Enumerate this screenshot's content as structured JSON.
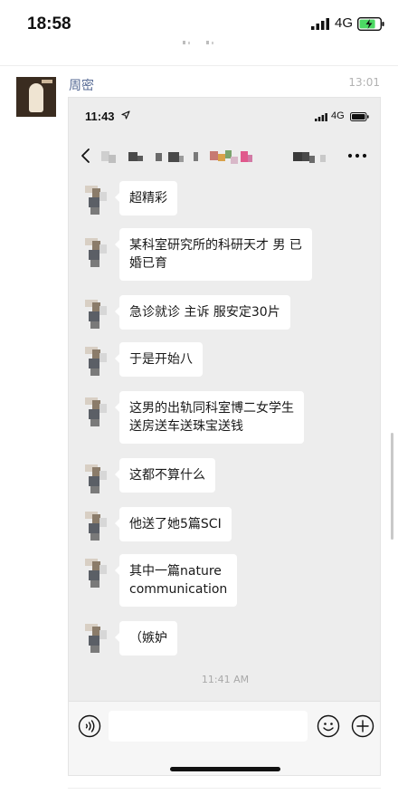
{
  "status_bar": {
    "time": "18:58",
    "network": "4G"
  },
  "moment": {
    "sender": "周密",
    "post_time": "13:01"
  },
  "screenshot": {
    "status_bar": {
      "time": "11:43",
      "network": "4G"
    },
    "messages": [
      {
        "text": "超精彩"
      },
      {
        "text": "某科室研究所的科研天才 男 已\n婚已育"
      },
      {
        "text": "急诊就诊 主诉 服安定30片"
      },
      {
        "text": "于是开始八"
      },
      {
        "text": "这男的出轨同科室博二女学生\n送房送车送珠宝送钱"
      },
      {
        "text": "这都不算什么"
      },
      {
        "text": "他送了她5篇SCI"
      },
      {
        "text": "其中一篇nature\ncommunication"
      },
      {
        "text": "（嫉妒"
      }
    ],
    "chat_time": "11:41 AM"
  },
  "colors": {
    "sender_name": "#576b95",
    "chat_bg": "#ededed",
    "bubble_bg": "#ffffff",
    "timestamp": "#b2b2b2"
  },
  "icons": [
    "signal-icon",
    "battery-charging-icon",
    "location-arrow-icon",
    "back-chevron-icon",
    "more-icon",
    "voice-icon",
    "emoji-icon",
    "plus-icon"
  ]
}
